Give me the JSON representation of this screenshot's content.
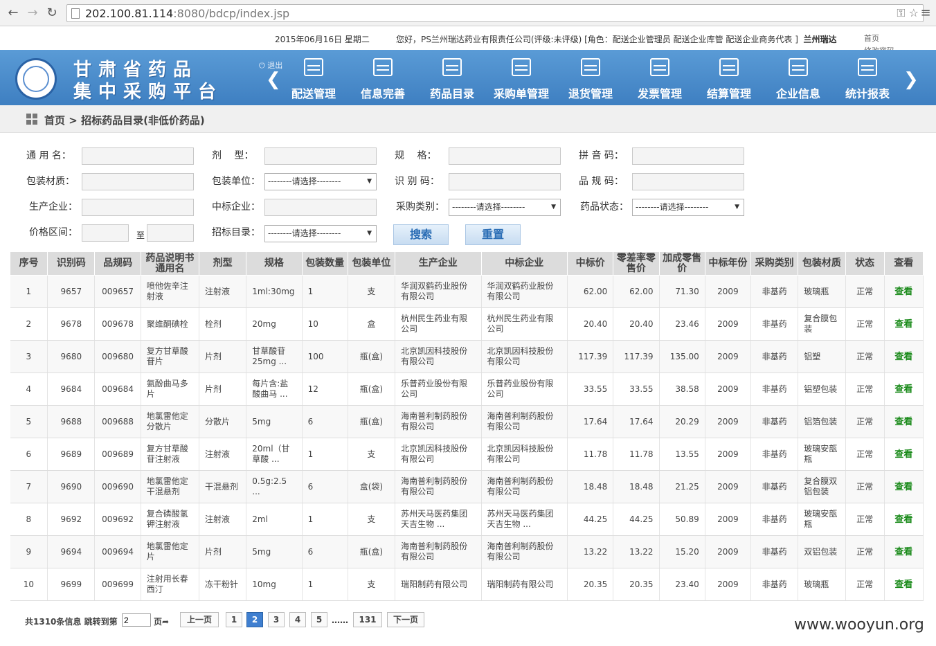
{
  "browser": {
    "url_host": "202.100.81.114",
    "url_path": ":8080/bdcp/index.jsp"
  },
  "info": {
    "date": "2015年06月16日 星期二",
    "greeting": "您好，PS兰州瑞达药业有限责任公司(评级:未评级) [角色：配送企业管理员 配送企业库管 配送企业商务代表 ]",
    "city": "兰州瑞达",
    "link_home": "首页",
    "link_password": "修改密码"
  },
  "header": {
    "title_line1": "甘肃省药品",
    "title_line2": "集中采购平台",
    "logout": "退出",
    "menu": [
      {
        "label": "配送管理",
        "icon": "calendar-icon"
      },
      {
        "label": "信息完善",
        "icon": "calendar-icon"
      },
      {
        "label": "药品目录",
        "icon": "calendar-icon"
      },
      {
        "label": "采购单管理",
        "icon": "picture-icon"
      },
      {
        "label": "退货管理",
        "icon": "document-icon"
      },
      {
        "label": "发票管理",
        "icon": "clipboard-icon"
      },
      {
        "label": "结算管理",
        "icon": "chart-icon"
      },
      {
        "label": "企业信息",
        "icon": "calendar-icon"
      },
      {
        "label": "统计报表",
        "icon": "calendar-icon"
      }
    ]
  },
  "breadcrumb": {
    "home": "首页",
    "sep": ">",
    "current": "招标药品目录(非低价药品)"
  },
  "form": {
    "labels": {
      "generic_name": "通 用 名：",
      "dosage_form": "剂　 型：",
      "spec": "规　 格：",
      "pinyin_code": "拼 音 码：",
      "pack_material": "包装材质：",
      "pack_unit": "包装单位：",
      "id_code": "识 别 码：",
      "product_code": "品 规 码：",
      "manufacturer": "生产企业：",
      "bid_company": "中标企业：",
      "purchase_type": "采购类别：",
      "drug_status": "药品状态：",
      "price_range": "价格区间：",
      "to": "至",
      "bid_catalog": "招标目录："
    },
    "select_placeholder": "--------请选择--------",
    "search_button": "搜索",
    "reset_button": "重置"
  },
  "table": {
    "headers": [
      "序号",
      "识别码",
      "品规码",
      "药品说明书通用名",
      "剂型",
      "规格",
      "包装数量",
      "包装单位",
      "生产企业",
      "中标企业",
      "中标价",
      "零差率零售价",
      "加成零售价",
      "中标年份",
      "采购类别",
      "包装材质",
      "状态",
      "查看"
    ],
    "rows": [
      [
        "1",
        "9657",
        "009657",
        "喷他佐辛注射液",
        "注射液",
        "1ml:30mg",
        "1",
        "支",
        "华润双鹤药业股份有限公司",
        "华润双鹤药业股份有限公司",
        "62.00",
        "62.00",
        "71.30",
        "2009",
        "非基药",
        "玻璃瓶",
        "正常",
        "查看"
      ],
      [
        "2",
        "9678",
        "009678",
        "聚维酮碘栓",
        "栓剂",
        "20mg",
        "10",
        "盒",
        "杭州民生药业有限公司",
        "杭州民生药业有限公司",
        "20.40",
        "20.40",
        "23.46",
        "2009",
        "非基药",
        "复合膜包装",
        "正常",
        "查看"
      ],
      [
        "3",
        "9680",
        "009680",
        "复方甘草酸苷片",
        "片剂",
        "甘草酸苷25mg ...",
        "100",
        "瓶(盒)",
        "北京凯因科技股份有限公司",
        "北京凯因科技股份有限公司",
        "117.39",
        "117.39",
        "135.00",
        "2009",
        "非基药",
        "铝塑",
        "正常",
        "查看"
      ],
      [
        "4",
        "9684",
        "009684",
        "氨酚曲马多片",
        "片剂",
        "每片含:盐酸曲马 ...",
        "12",
        "瓶(盒)",
        "乐普药业股份有限公司",
        "乐普药业股份有限公司",
        "33.55",
        "33.55",
        "38.58",
        "2009",
        "非基药",
        "铝塑包装",
        "正常",
        "查看"
      ],
      [
        "5",
        "9688",
        "009688",
        "地氯雷他定分散片",
        "分散片",
        "5mg",
        "6",
        "瓶(盒)",
        "海南普利制药股份有限公司",
        "海南普利制药股份有限公司",
        "17.64",
        "17.64",
        "20.29",
        "2009",
        "非基药",
        "铝箔包装",
        "正常",
        "查看"
      ],
      [
        "6",
        "9689",
        "009689",
        "复方甘草酸苷注射液",
        "注射液",
        "20ml（甘草酸 ...",
        "1",
        "支",
        "北京凯因科技股份有限公司",
        "北京凯因科技股份有限公司",
        "11.78",
        "11.78",
        "13.55",
        "2009",
        "非基药",
        "玻璃安瓿瓶",
        "正常",
        "查看"
      ],
      [
        "7",
        "9690",
        "009690",
        "地氯雷他定干混悬剂",
        "干混悬剂",
        "0.5g:2.5 ...",
        "6",
        "盒(袋)",
        "海南普利制药股份有限公司",
        "海南普利制药股份有限公司",
        "18.48",
        "18.48",
        "21.25",
        "2009",
        "非基药",
        "复合膜双铝包装",
        "正常",
        "查看"
      ],
      [
        "8",
        "9692",
        "009692",
        "复合磷酸氢钾注射液",
        "注射液",
        "2ml",
        "1",
        "支",
        "苏州天马医药集团天吉生物 ...",
        "苏州天马医药集团天吉生物 ...",
        "44.25",
        "44.25",
        "50.89",
        "2009",
        "非基药",
        "玻璃安瓿瓶",
        "正常",
        "查看"
      ],
      [
        "9",
        "9694",
        "009694",
        "地氯雷他定片",
        "片剂",
        "5mg",
        "6",
        "瓶(盒)",
        "海南普利制药股份有限公司",
        "海南普利制药股份有限公司",
        "13.22",
        "13.22",
        "15.20",
        "2009",
        "非基药",
        "双铝包装",
        "正常",
        "查看"
      ],
      [
        "10",
        "9699",
        "009699",
        "注射用长春西汀",
        "冻干粉针",
        "10mg",
        "1",
        "支",
        "瑞阳制药有限公司",
        "瑞阳制药有限公司",
        "20.35",
        "20.35",
        "23.40",
        "2009",
        "非基药",
        "玻璃瓶",
        "正常",
        "查看"
      ]
    ]
  },
  "pager": {
    "total_text": "共1310条信息 跳转到第",
    "jump_value": "2",
    "page_suffix": "页",
    "prev": "上一页",
    "pages": [
      "1",
      "2",
      "3",
      "4",
      "5"
    ],
    "active_page": "2",
    "ellipsis": "……",
    "last_page": "131",
    "next": "下一页"
  },
  "watermark": "www.wooyun.org"
}
